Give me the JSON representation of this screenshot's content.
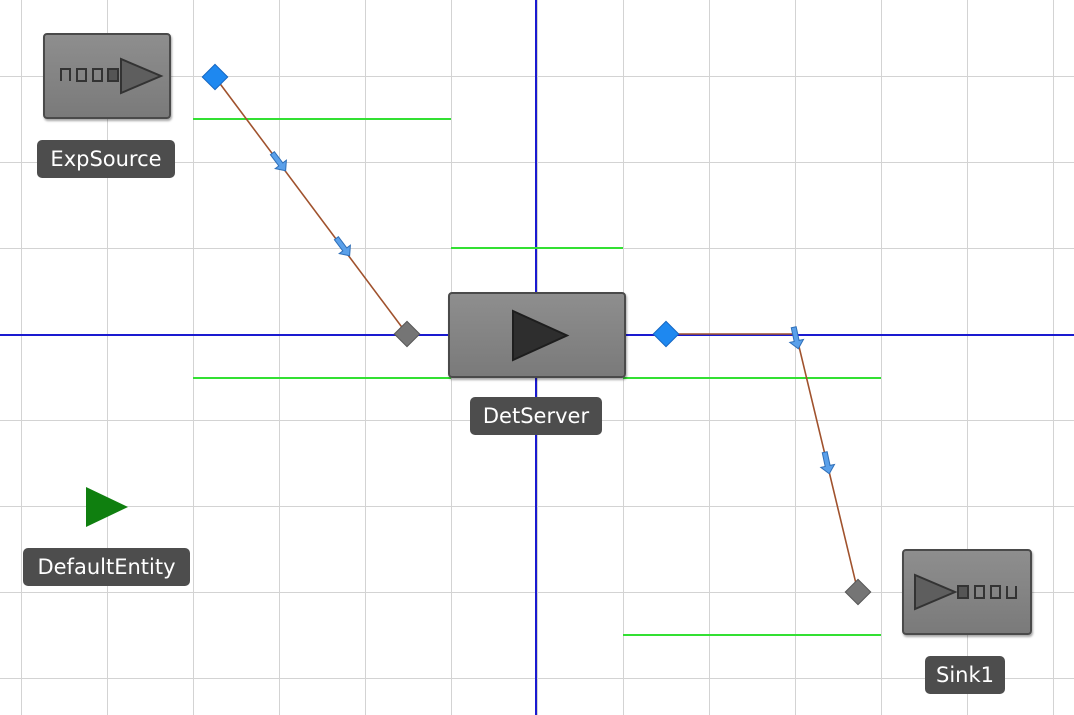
{
  "components": {
    "source": {
      "label": "ExpSource",
      "icon": "exp-source-icon"
    },
    "server": {
      "label": "DetServer",
      "icon": "det-server-icon"
    },
    "sink": {
      "label": "Sink1",
      "icon": "sink-icon"
    },
    "entity": {
      "label": "DefaultEntity",
      "icon": "entity-triangle-icon"
    }
  },
  "connections": [
    {
      "from": "ExpSource",
      "to": "DetServer"
    },
    {
      "from": "DetServer",
      "to": "Sink1"
    }
  ],
  "colors": {
    "grid": "#d3d3d3",
    "axis": "#1a1ad0",
    "bounding_lines": "#33e033",
    "block_fill": "#848484",
    "label_bg": "#4d4d4d",
    "label_text": "#ffffff",
    "entity": "#0f7f0f",
    "output_port": "#1e88f0",
    "input_port": "#757575",
    "connector": "#a0522d",
    "flow_arrow": "#4a90e2"
  }
}
